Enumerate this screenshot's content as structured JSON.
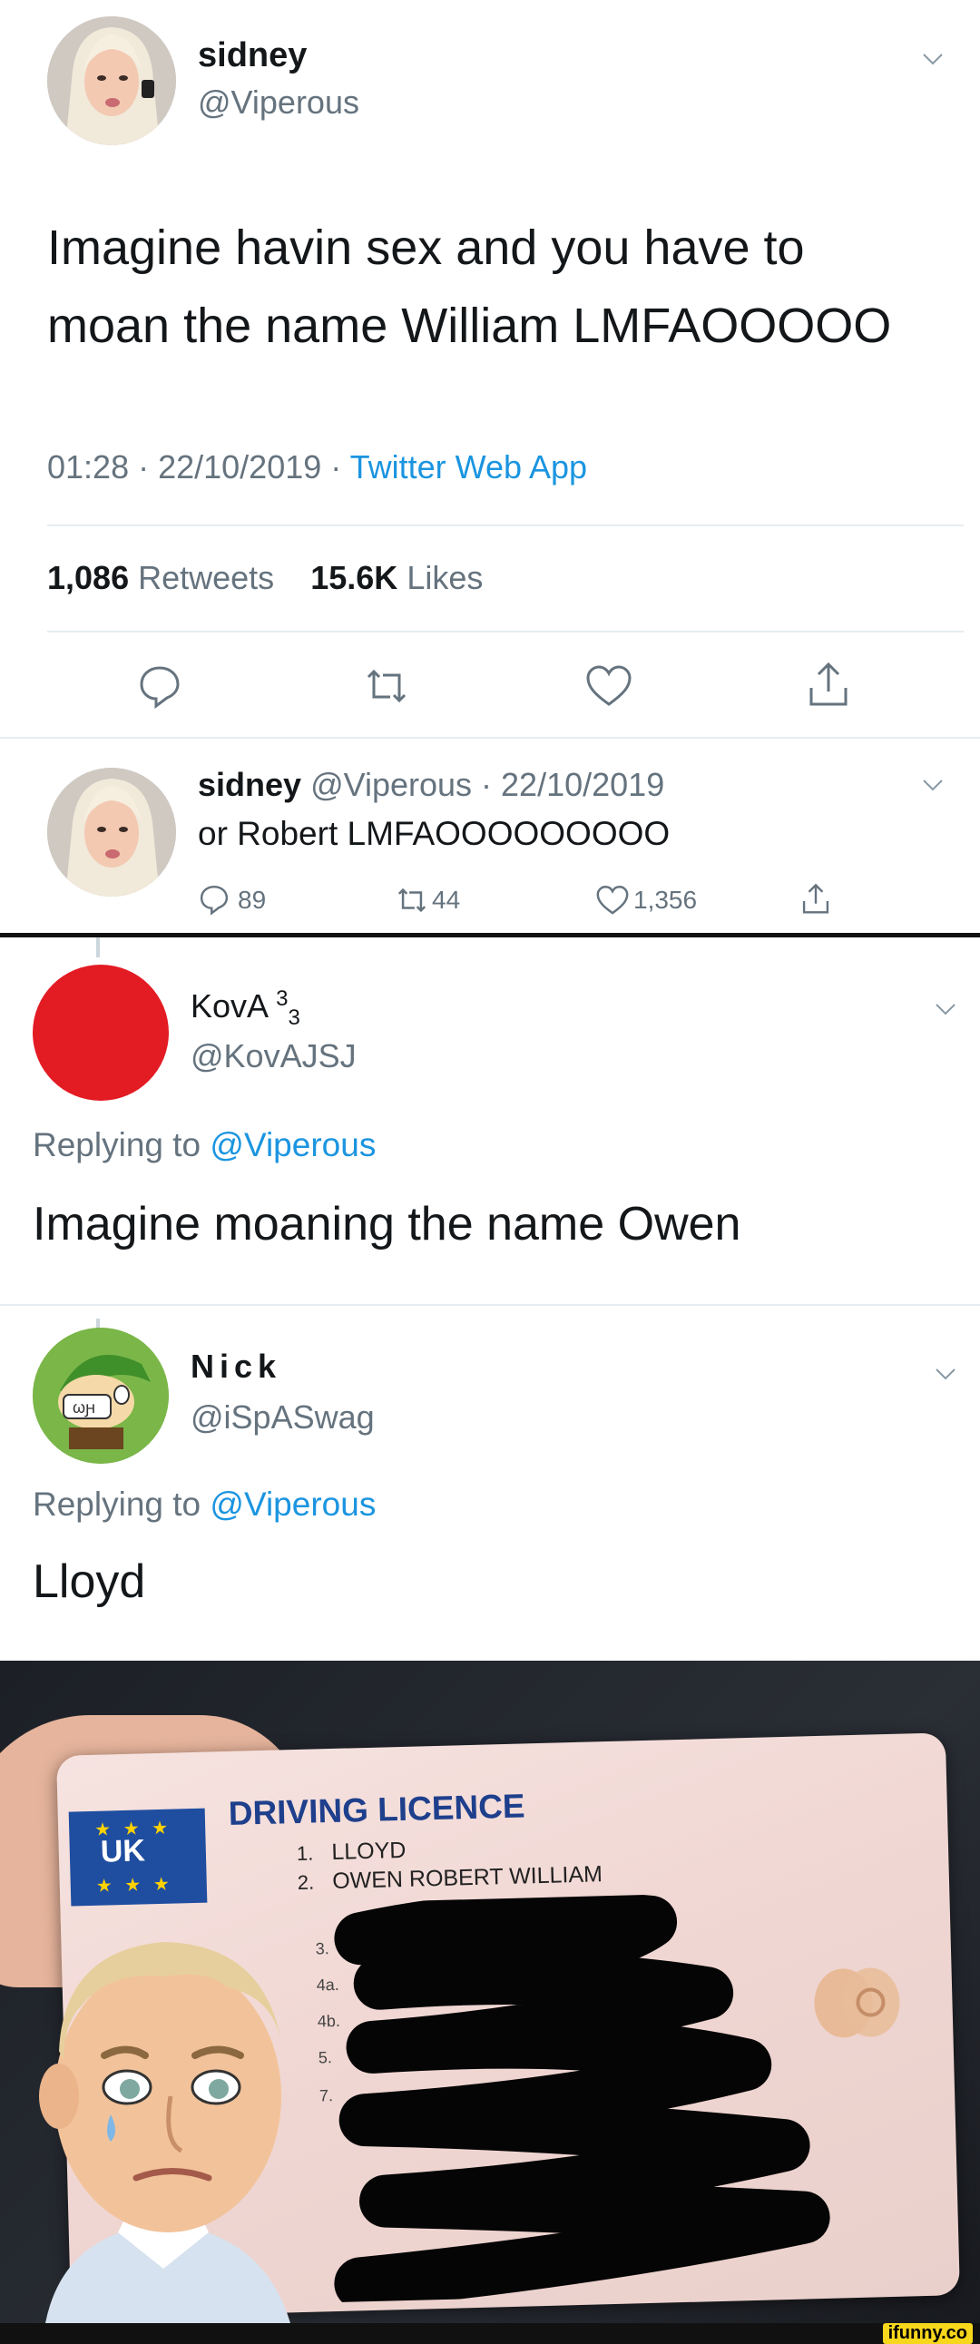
{
  "tweet1": {
    "name": "sidney",
    "handle": "@Viperous",
    "text_line1": "Imagine havin sex and you have to",
    "text_line2": "moan the name William LMFAOOOOO",
    "time": "01:28 · 22/10/2019 · ",
    "source": "Twitter Web App",
    "retweets_count": "1,086",
    "retweets_label": "Retweets",
    "likes_count": "15.6K",
    "likes_label": "Likes"
  },
  "tweet2": {
    "name": "sidney",
    "meta": "@Viperous · 22/10/2019",
    "text": "or Robert LMFAOOOOOOOOO",
    "replies": "89",
    "retweets": "44",
    "likes": "1,356"
  },
  "reply1": {
    "name": "KovA",
    "name_sup": "3",
    "name_sub": "3",
    "handle": "@KovAJSJ",
    "replying_prefix": "Replying to ",
    "replying_handle": "@Viperous",
    "text": "Imagine moaning the name Owen"
  },
  "reply2": {
    "name": "Nick",
    "handle": "@iSpASwag",
    "replying_prefix": "Replying to ",
    "replying_handle": "@Viperous",
    "text": "Lloyd"
  },
  "meme": {
    "card_title": "DRIVING LICENCE",
    "line1_num": "1.",
    "line1": "LLOYD",
    "line2_num": "2.",
    "line2": "OWEN ROBERT WILLIAM",
    "field_nums": [
      "3.",
      "4a.",
      "4b.",
      "5.",
      "7."
    ],
    "eu_badge": "UK",
    "watermark": "ifunny.co"
  },
  "colors": {
    "accent": "#1b95e0",
    "text": "#14171a",
    "muted": "#65737e",
    "red_avatar": "#e31b23"
  }
}
